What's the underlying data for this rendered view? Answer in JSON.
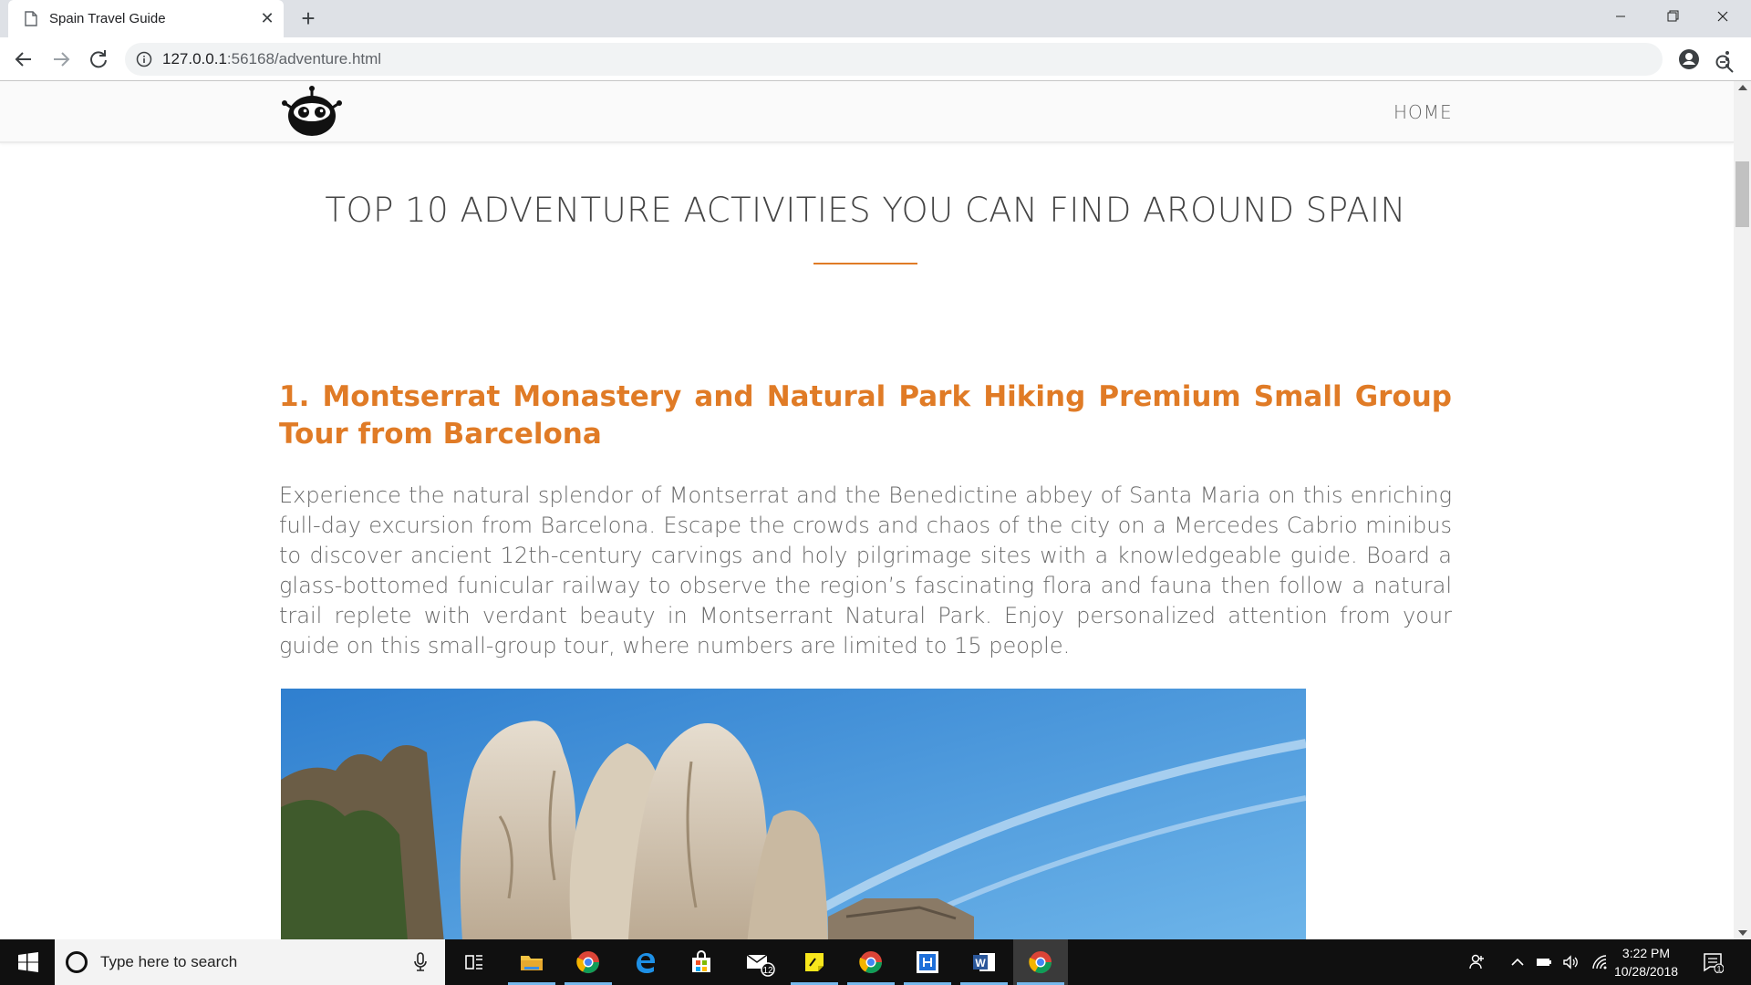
{
  "browser": {
    "tab_title": "Spain Travel Guide",
    "url_host": "127.0.0.1",
    "url_rest": ":56168/adventure.html"
  },
  "site": {
    "nav_home": "HOME"
  },
  "page": {
    "title": "TOP 10 ADVENTURE ACTIVITIES YOU CAN FIND AROUND SPAIN",
    "activity_title": "1. Montserrat Monastery and Natural Park Hiking Premium Small Group Tour from Barcelona",
    "activity_description": "Experience the natural splendor of Montserrat and the Benedictine abbey of Santa Maria on this enriching full-day excursion from Barcelona. Escape the crowds and chaos of the city on a Mercedes Cabrio minibus to discover ancient 12th-century carvings and holy pilgrimage sites with a knowledgeable guide. Board a glass-bottomed funicular railway to observe the region’s fascinating flora and fauna then follow a natural trail replete with verdant beauty in Montserrant Natural Park. Enjoy personalized attention from your guide on this small-group tour, where numbers are limited to 15 people."
  },
  "taskbar": {
    "search_placeholder": "Type here to search",
    "mail_badge": "12",
    "time": "3:22 PM",
    "date": "10/28/2018",
    "notification_count": "1"
  },
  "colors": {
    "accent": "#e07b26"
  }
}
